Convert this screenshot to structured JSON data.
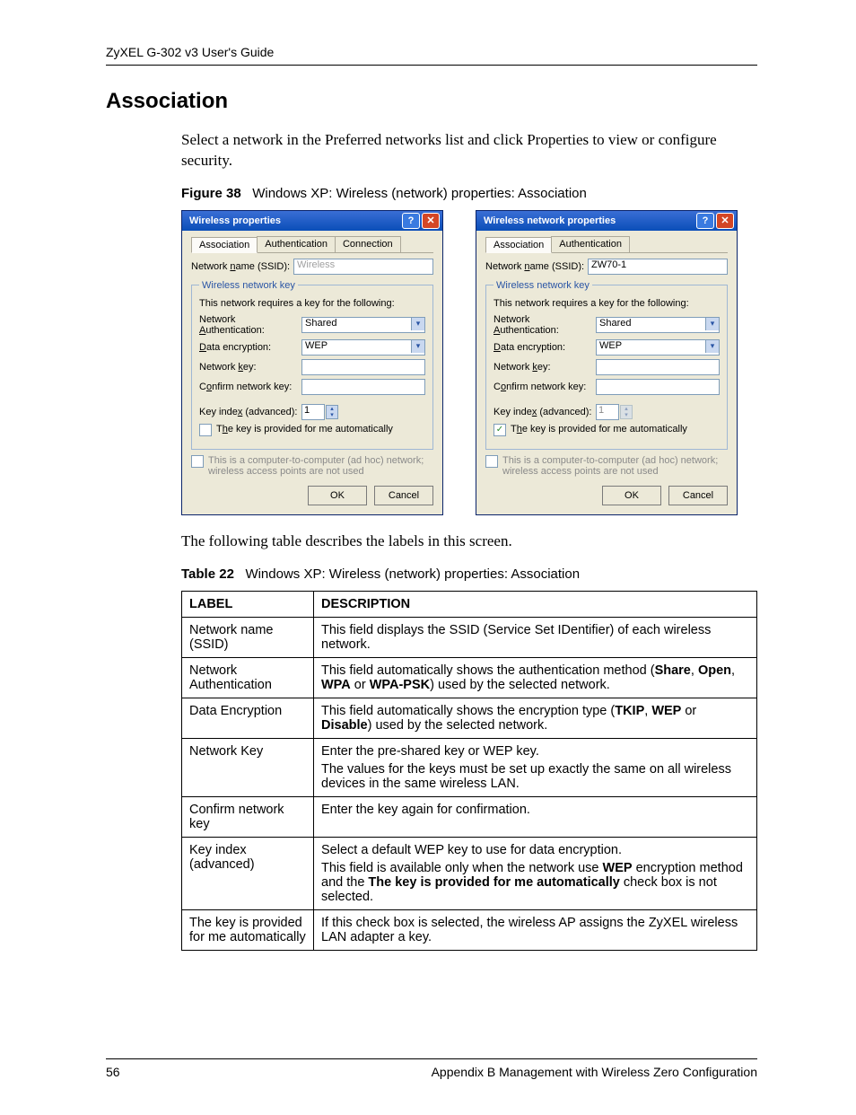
{
  "header": {
    "guide_title": "ZyXEL G-302 v3 User's Guide"
  },
  "section": {
    "title": "Association"
  },
  "intro_para": "Select a network in the Preferred networks list and click Properties to view or configure security.",
  "figure": {
    "num": "Figure 38",
    "caption": "Windows XP: Wireless (network) properties: Association"
  },
  "after_figure_para": "The following table describes the labels in this screen.",
  "table_cap": {
    "num": "Table 22",
    "caption": "Windows XP: Wireless (network) properties: Association"
  },
  "table": {
    "head_label": "LABEL",
    "head_desc": "DESCRIPTION",
    "rows": [
      {
        "label": "Network name (SSID)",
        "desc_plain": "This field displays the SSID (Service Set IDentifier) of each wireless network."
      },
      {
        "label": "Network Authentication",
        "desc_html": "This field automatically shows the authentication method (<b>Share</b>, <b>Open</b>, <b>WPA</b> or <b>WPA-PSK</b>) used by the selected network."
      },
      {
        "label": "Data Encryption",
        "desc_html": "This field automatically shows the encryption type (<b>TKIP</b>, <b>WEP</b> or <b>Disable</b>) used by the selected network."
      },
      {
        "label": "Network Key",
        "desc_html": "<p class='td-para'>Enter the pre-shared key or WEP key.</p><p class='td-para'>The values for the keys must be set up exactly the same on all wireless devices in the same wireless LAN.</p>"
      },
      {
        "label": "Confirm network key",
        "desc_plain": "Enter the key again for confirmation."
      },
      {
        "label": "Key index (advanced)",
        "desc_html": "<p class='td-para'>Select a default WEP key to use for data encryption.</p><p class='td-para'>This field is available only when the network use <b>WEP</b> encryption method and the <b>The key is provided for me automatically</b> check box is not selected.</p>"
      },
      {
        "label": "The key is provided for me automatically",
        "desc_plain": "If this check box is selected, the wireless AP assigns the ZyXEL wireless LAN adapter a key."
      }
    ]
  },
  "dialogs": {
    "left": {
      "title": "Wireless properties",
      "tabs": [
        "Association",
        "Authentication",
        "Connection"
      ],
      "active_tab": 0,
      "ssid_label": "Network name (SSID):",
      "ssid_value": "Wireless",
      "ssid_disabled": true,
      "groupbox_title": "Wireless network key",
      "group_intro": "This network requires a key for the following:",
      "auth_label": "Network Authentication:",
      "auth_value": "Shared",
      "enc_label": "Data encryption:",
      "enc_value": "WEP",
      "key_label": "Network key:",
      "confirm_label": "Confirm network key:",
      "index_label": "Key index (advanced):",
      "index_value": "1",
      "auto_label": "The key is provided for me automatically",
      "auto_checked": false,
      "adhoc_label": "This is a computer-to-computer (ad hoc) network; wireless access points are not used",
      "ok_label": "OK",
      "cancel_label": "Cancel"
    },
    "right": {
      "title": "Wireless network properties",
      "tabs": [
        "Association",
        "Authentication"
      ],
      "active_tab": 0,
      "ssid_label": "Network name (SSID):",
      "ssid_value": "ZW70-1",
      "ssid_disabled": false,
      "groupbox_title": "Wireless network key",
      "group_intro": "This network requires a key for the following:",
      "auth_label": "Network Authentication:",
      "auth_value": "Shared",
      "enc_label": "Data encryption:",
      "enc_value": "WEP",
      "key_label": "Network key:",
      "confirm_label": "Confirm network key:",
      "index_label": "Key index (advanced):",
      "index_value": "1",
      "auto_label": "The key is provided for me automatically",
      "auto_checked": true,
      "adhoc_label": "This is a computer-to-computer (ad hoc) network; wireless access points are not used",
      "ok_label": "OK",
      "cancel_label": "Cancel"
    }
  },
  "footer": {
    "page_num": "56",
    "appendix": "Appendix B Management with Wireless Zero Configuration"
  }
}
